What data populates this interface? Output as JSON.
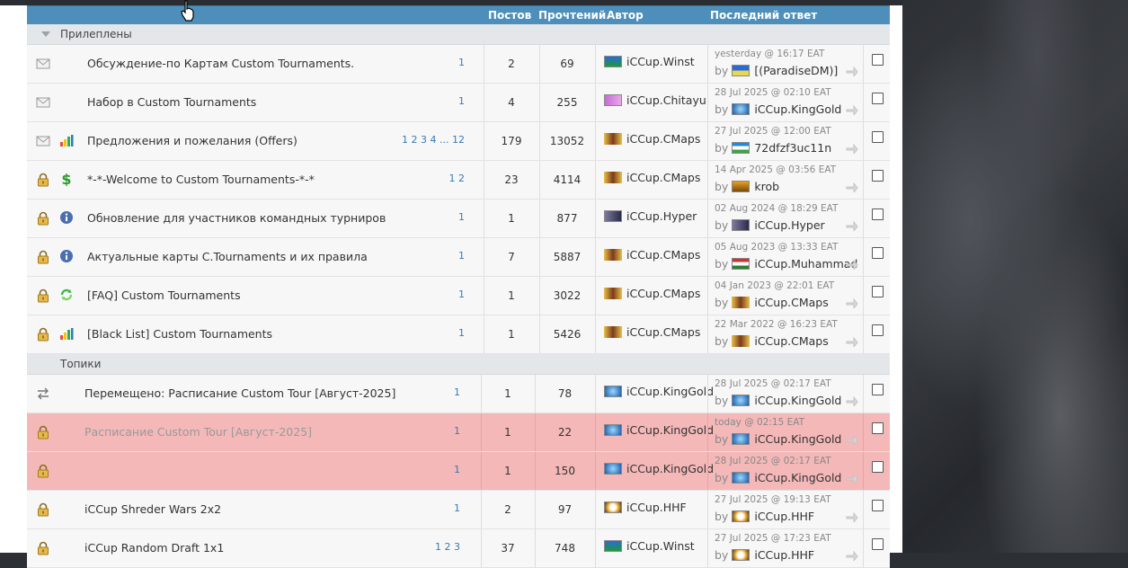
{
  "header": {
    "posts": "Постов",
    "views": "Прочтений",
    "author": "Автор",
    "last_reply": "Последний ответ"
  },
  "sections": {
    "pinned": "Прилеплены",
    "topics": "Топики"
  },
  "pinned_rows": [
    {
      "title": "Обсуждение-по Картам Custom Tournaments.",
      "pages": "1",
      "posts": "2",
      "views": "69",
      "author": "iCCup.Winst",
      "last_time": "yesterday @ 16:17 EAT",
      "by": "by",
      "last_user": "[(ParadiseDM)]"
    },
    {
      "title": "Набор в Custom Tournaments",
      "pages": "1",
      "posts": "4",
      "views": "255",
      "author": "iCCup.Chitayu",
      "last_time": "28 Jul 2025 @ 02:10 EAT",
      "by": "by",
      "last_user": "iCCup.KingGold"
    },
    {
      "title": "Предложения и пожелания (Offers)",
      "pages": "1 2 3 4 ... 12",
      "posts": "179",
      "views": "13052",
      "author": "iCCup.CMaps",
      "last_time": "27 Jul 2025 @ 12:00 EAT",
      "by": "by",
      "last_user": "72dfzf3uc11n"
    },
    {
      "title": "*-*-Welcome to Custom Tournaments-*-*",
      "pages": "1 2",
      "posts": "23",
      "views": "4114",
      "author": "iCCup.CMaps",
      "last_time": "14 Apr 2025 @ 03:56 EAT",
      "by": "by",
      "last_user": "krob"
    },
    {
      "title": "Обновление для участников командных турниров",
      "pages": "1",
      "posts": "1",
      "views": "877",
      "author": "iCCup.Hyper",
      "last_time": "02 Aug 2024 @ 18:29 EAT",
      "by": "by",
      "last_user": "iCCup.Hyper"
    },
    {
      "title": "Актуальные карты C.Tournaments и их правила",
      "pages": "1",
      "posts": "7",
      "views": "5887",
      "author": "iCCup.CMaps",
      "last_time": "05 Aug 2023 @ 13:33 EAT",
      "by": "by",
      "last_user": "iCCup.Muhammad"
    },
    {
      "title": "[FAQ] Custom Tournaments",
      "pages": "1",
      "posts": "1",
      "views": "3022",
      "author": "iCCup.CMaps",
      "last_time": "04 Jan 2023 @ 22:01 EAT",
      "by": "by",
      "last_user": "iCCup.CMaps"
    },
    {
      "title": "[Black List] Custom Tournaments",
      "pages": "1",
      "posts": "1",
      "views": "5426",
      "author": "iCCup.CMaps",
      "last_time": "22 Mar 2022 @ 16:23 EAT",
      "by": "by",
      "last_user": "iCCup.CMaps"
    }
  ],
  "topic_rows": [
    {
      "title": "Перемещено: Расписание Custom Tour [Август-2025]",
      "pages": "1",
      "posts": "1",
      "views": "78",
      "author": "iCCup.KingGold",
      "last_time": "28 Jul 2025 @ 02:17 EAT",
      "by": "by",
      "last_user": "iCCup.KingGold"
    },
    {
      "title": "Расписание Custom Tour [Август-2025]",
      "pages": "1",
      "posts": "1",
      "views": "22",
      "author": "iCCup.KingGold",
      "last_time": "today @ 02:15 EAT",
      "by": "by",
      "last_user": "iCCup.KingGold"
    },
    {
      "title": "",
      "pages": "1",
      "posts": "1",
      "views": "150",
      "author": "iCCup.KingGold",
      "last_time": "28 Jul 2025 @ 02:17 EAT",
      "by": "by",
      "last_user": "iCCup.KingGold"
    },
    {
      "title": "iCCup Shreder Wars 2x2",
      "pages": "1",
      "posts": "2",
      "views": "97",
      "author": "iCCup.HHF",
      "last_time": "27 Jul 2025 @ 19:13 EAT",
      "by": "by",
      "last_user": "iCCup.HHF"
    },
    {
      "title": "iCCup Random Draft 1x1",
      "pages": "1 2 3",
      "posts": "37",
      "views": "748",
      "author": "iCCup.Winst",
      "last_time": "27 Jul 2025 @ 17:23 EAT",
      "by": "by",
      "last_user": "iCCup.HHF"
    }
  ],
  "colors": {
    "header_bg": "#4d8fba",
    "highlight_row": "#f4b8b8",
    "link": "#3a7ab0"
  },
  "icons": {
    "envelope": "envelope-icon",
    "lock": "lock-icon",
    "chart": "bar-chart-icon",
    "dollar": "dollar-icon",
    "info": "info-icon",
    "refresh": "refresh-icon",
    "moved": "moved-arrows-icon"
  }
}
